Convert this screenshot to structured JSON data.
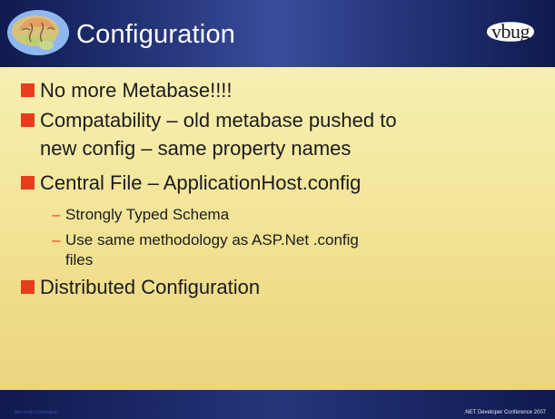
{
  "slide": {
    "title": "Configuration",
    "logo_right_text": "vbug",
    "footer_left": "Microsoft Corporation",
    "footer_right": ".NET Developer Conference 2007",
    "accent_color": "#e63d1c",
    "header_color": "#24357a",
    "bullets": [
      {
        "text": "No more Metabase!!!!",
        "lines": [
          "No more Metabase!!!!"
        ]
      },
      {
        "text": "Compatability – old metabase pushed to new config – same property names",
        "lines": [
          "Compatability – old metabase pushed to",
          "new config – same property names"
        ]
      },
      {
        "text": "Central File – ApplicationHost.config",
        "lines": [
          "Central File – ApplicationHost.config"
        ],
        "sub": [
          {
            "text": "Strongly Typed Schema",
            "lines": [
              "Strongly Typed Schema"
            ]
          },
          {
            "text": "Use same methodology as ASP.Net .config files",
            "lines": [
              "Use same methodology as ASP.Net .config",
              "files"
            ]
          }
        ]
      },
      {
        "text": "Distributed Configuration",
        "lines": [
          "Distributed Configuration"
        ]
      }
    ],
    "sub_marker": "–"
  }
}
